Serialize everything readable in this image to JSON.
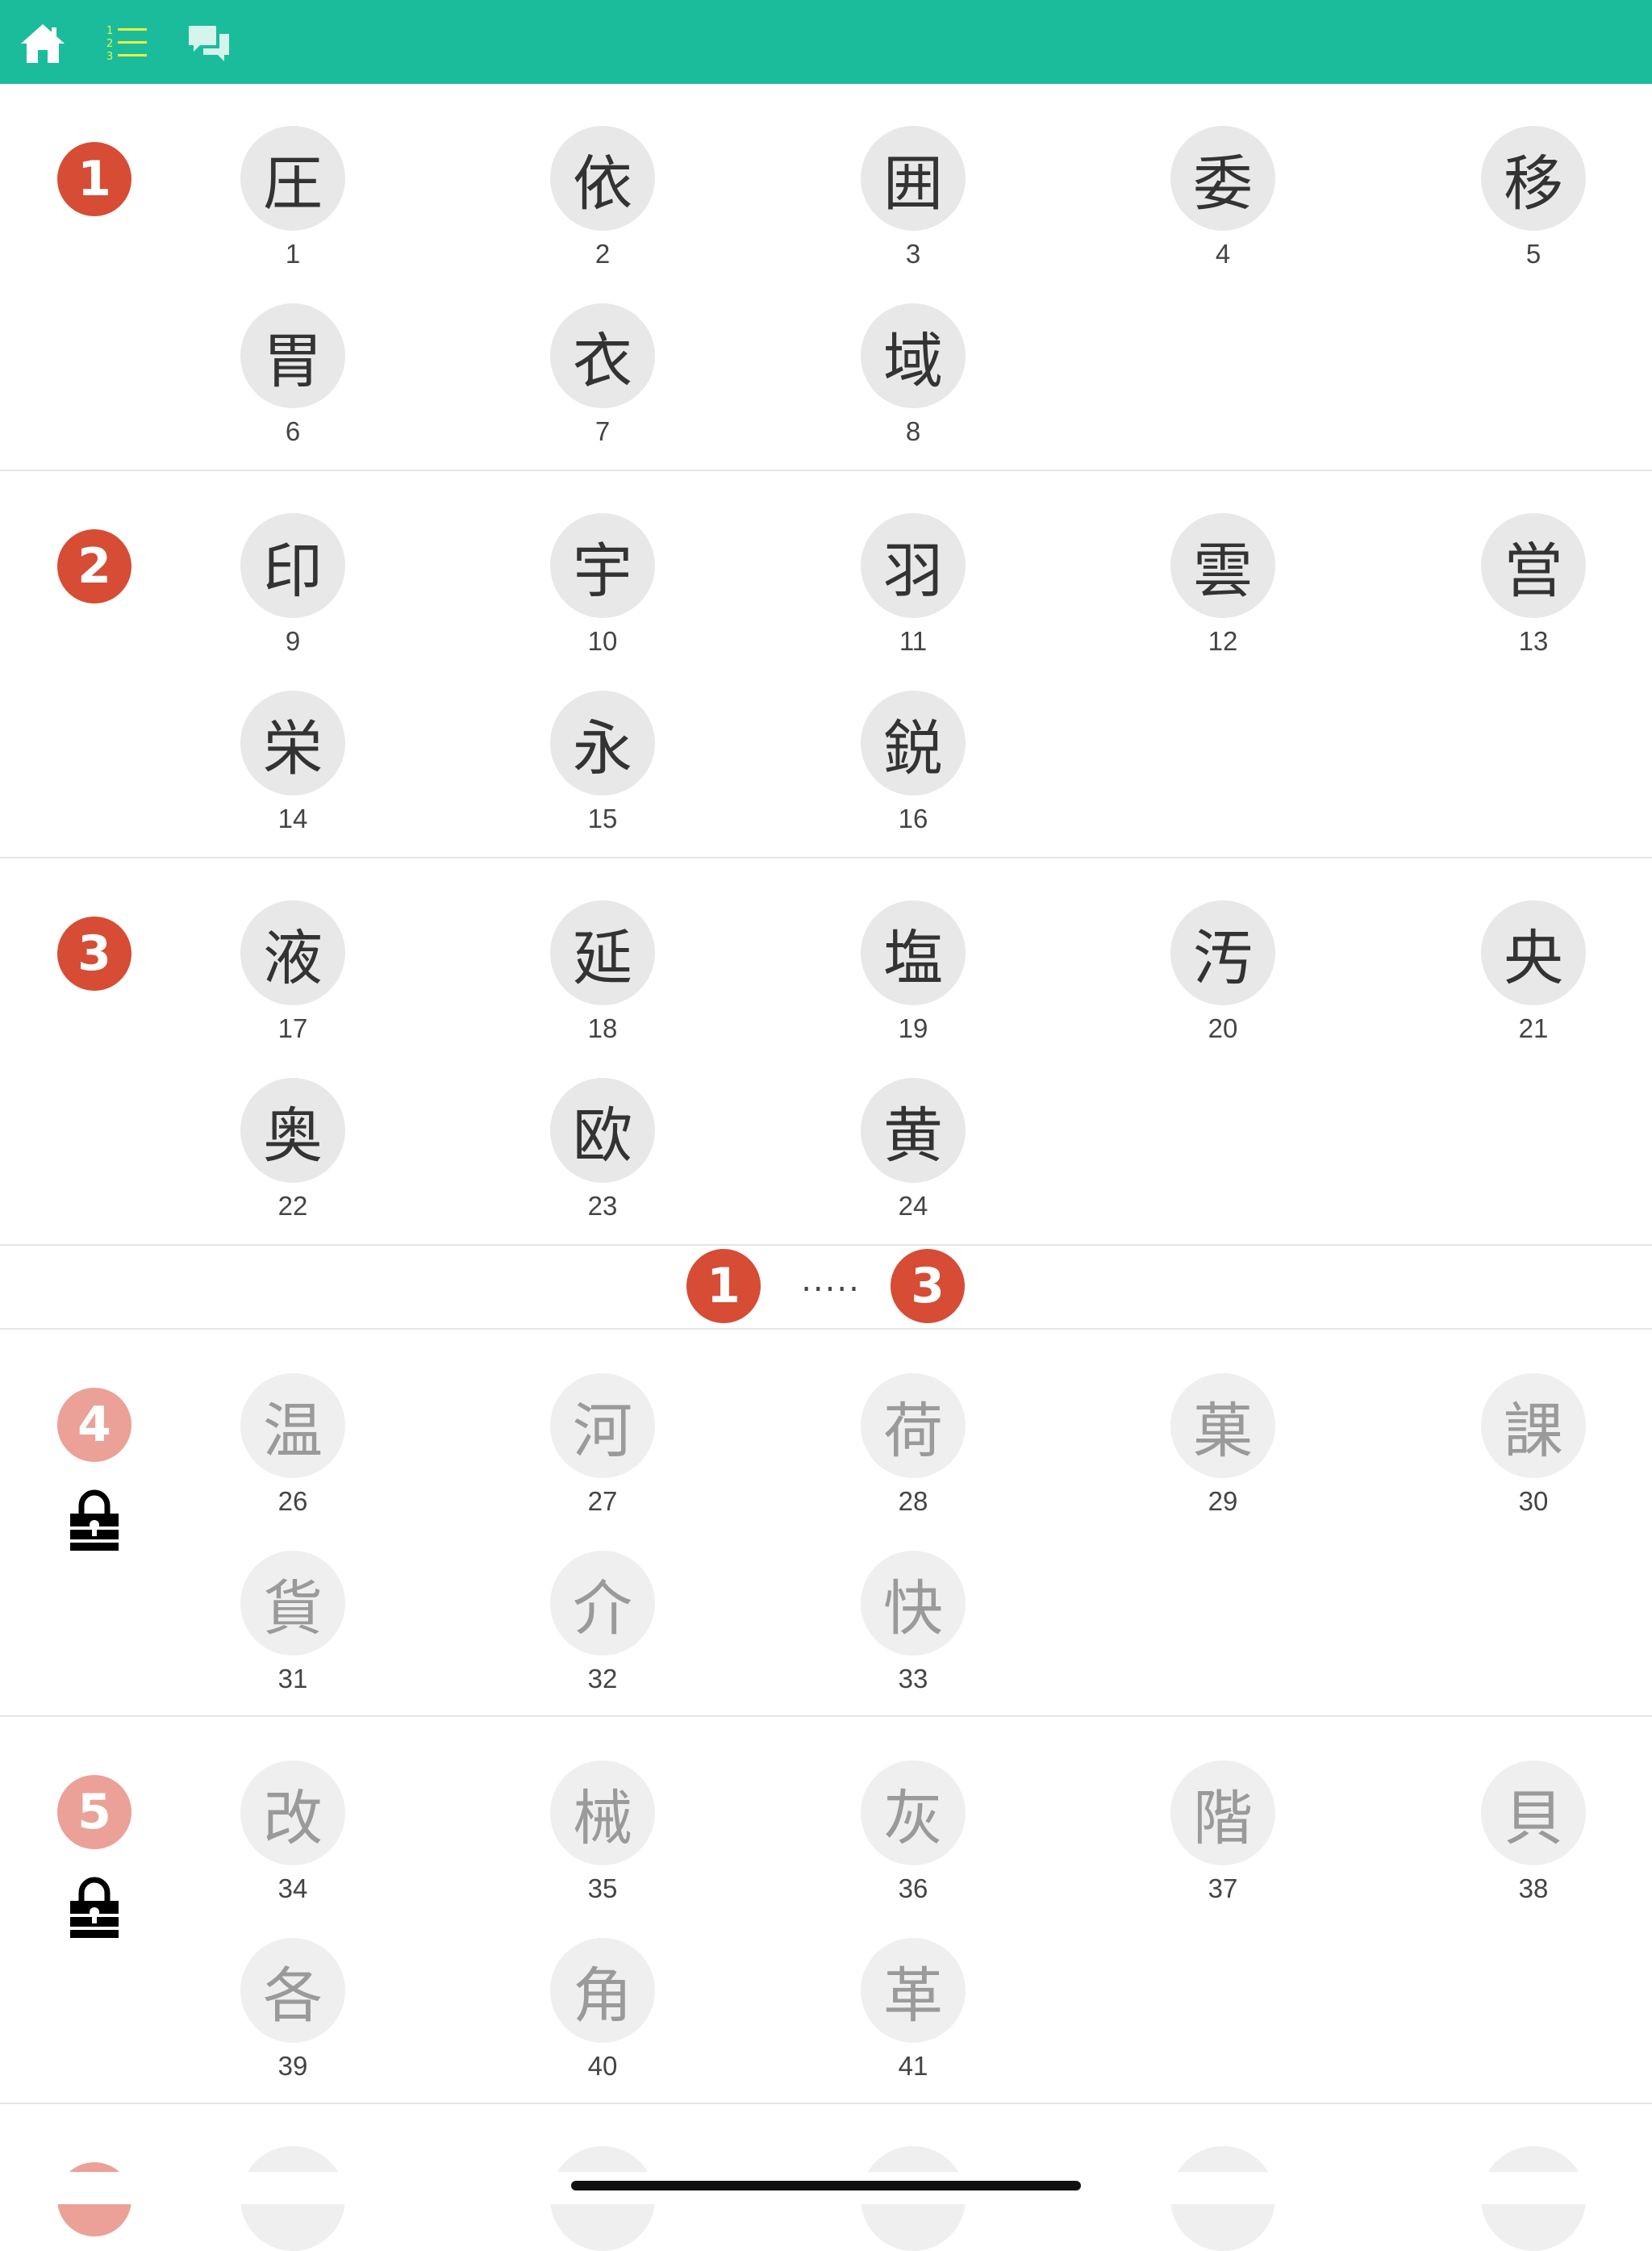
{
  "toolbar": {
    "icons": [
      "home-icon",
      "numbered-list-icon",
      "chat-bubbles-icon"
    ],
    "colors": {
      "bar": "#1bbc9b",
      "home": "#ffffff",
      "list": "#e8f542",
      "chat": "#d4f4ec"
    }
  },
  "colors": {
    "badge": "#d64c35",
    "badge_locked": "#eba197",
    "circle": "#e8e8e8",
    "circle_locked": "#efefef",
    "text_locked": "#9a9a9a"
  },
  "sections": [
    {
      "number": "1",
      "locked": false,
      "items": [
        {
          "kanji": "圧",
          "num": "1"
        },
        {
          "kanji": "依",
          "num": "2"
        },
        {
          "kanji": "囲",
          "num": "3"
        },
        {
          "kanji": "委",
          "num": "4"
        },
        {
          "kanji": "移",
          "num": "5"
        },
        {
          "kanji": "胃",
          "num": "6"
        },
        {
          "kanji": "衣",
          "num": "7"
        },
        {
          "kanji": "域",
          "num": "8"
        }
      ]
    },
    {
      "number": "2",
      "locked": false,
      "items": [
        {
          "kanji": "印",
          "num": "9"
        },
        {
          "kanji": "宇",
          "num": "10"
        },
        {
          "kanji": "羽",
          "num": "11"
        },
        {
          "kanji": "雲",
          "num": "12"
        },
        {
          "kanji": "営",
          "num": "13"
        },
        {
          "kanji": "栄",
          "num": "14"
        },
        {
          "kanji": "永",
          "num": "15"
        },
        {
          "kanji": "鋭",
          "num": "16"
        }
      ]
    },
    {
      "number": "3",
      "locked": false,
      "items": [
        {
          "kanji": "液",
          "num": "17"
        },
        {
          "kanji": "延",
          "num": "18"
        },
        {
          "kanji": "塩",
          "num": "19"
        },
        {
          "kanji": "汚",
          "num": "20"
        },
        {
          "kanji": "央",
          "num": "21"
        },
        {
          "kanji": "奥",
          "num": "22"
        },
        {
          "kanji": "欧",
          "num": "23"
        },
        {
          "kanji": "黄",
          "num": "24"
        }
      ]
    },
    {
      "number": "4",
      "locked": true,
      "items": [
        {
          "kanji": "温",
          "num": "26"
        },
        {
          "kanji": "河",
          "num": "27"
        },
        {
          "kanji": "荷",
          "num": "28"
        },
        {
          "kanji": "菓",
          "num": "29"
        },
        {
          "kanji": "課",
          "num": "30"
        },
        {
          "kanji": "貨",
          "num": "31"
        },
        {
          "kanji": "介",
          "num": "32"
        },
        {
          "kanji": "快",
          "num": "33"
        }
      ]
    },
    {
      "number": "5",
      "locked": true,
      "items": [
        {
          "kanji": "改",
          "num": "34"
        },
        {
          "kanji": "械",
          "num": "35"
        },
        {
          "kanji": "灰",
          "num": "36"
        },
        {
          "kanji": "階",
          "num": "37"
        },
        {
          "kanji": "貝",
          "num": "38"
        },
        {
          "kanji": "各",
          "num": "39"
        },
        {
          "kanji": "角",
          "num": "40"
        },
        {
          "kanji": "革",
          "num": "41"
        }
      ]
    }
  ],
  "progress": {
    "start": "1",
    "dots": ".....",
    "end": "3"
  }
}
